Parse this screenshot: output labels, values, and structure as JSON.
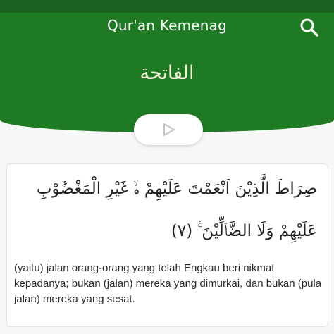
{
  "app": {
    "title": "Qur'an Kemenag",
    "search_icon": "search-icon"
  },
  "surah": {
    "name_arabic": "الفاتحة"
  },
  "player": {
    "play_icon": "play-icon"
  },
  "ayah": {
    "arabic": "صِرَاطَ الَّذِيْنَ اَنْعَمْتَ عَلَيْهِمْ ەۙ غَيْرِ الْمَغْضُوْبِ عَلَيْهِمْ وَلَا الضَّاۤلِّيْنَ ࣖ (٧)",
    "translation": "(yaitu) jalan orang-orang yang telah Engkau beri nikmat kepadanya; bukan (jalan) mereka yang dimurkai, dan bukan (pula jalan) mereka yang sesat."
  },
  "colors": {
    "header_green": "#1e7b24",
    "status_green": "#1f5e22",
    "header_text": "#ffffff",
    "surah_text": "#f4f1d8",
    "background": "#f7f7f7",
    "play_icon": "#c4c4c4"
  }
}
